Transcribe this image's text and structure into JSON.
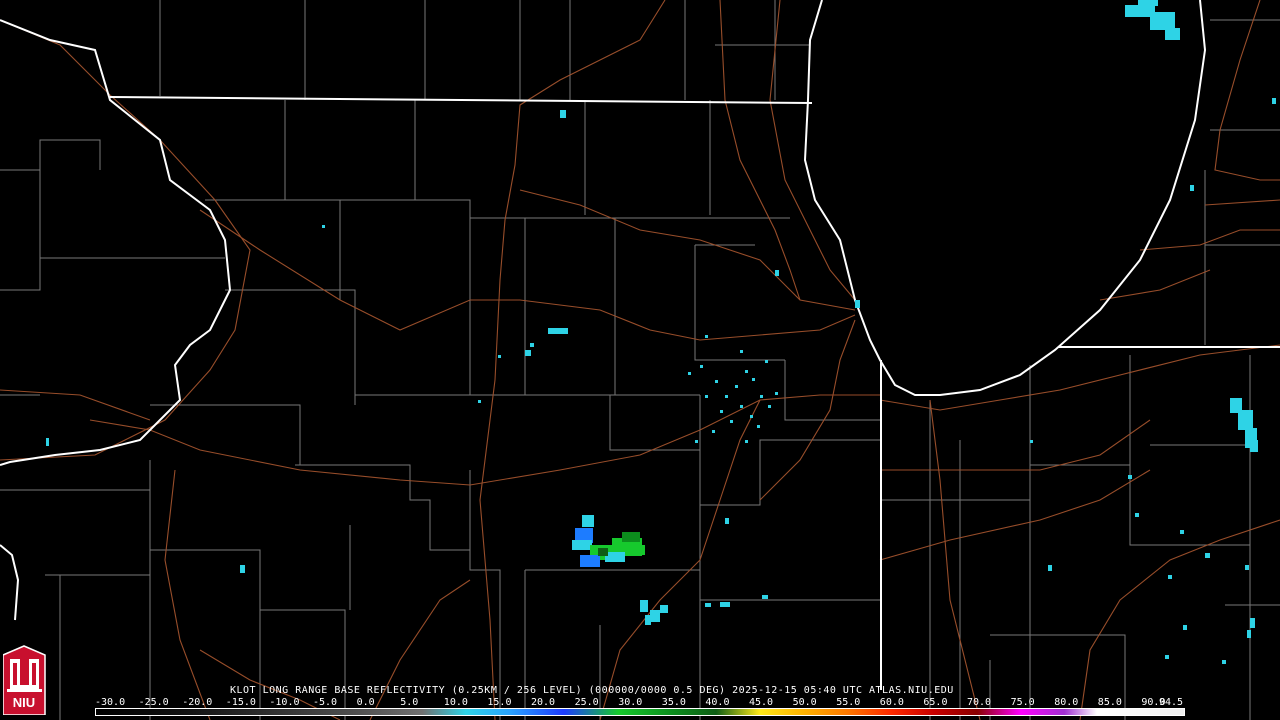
{
  "product": {
    "title": "KLOT LONG RANGE BASE REFLECTIVITY (0.25KM / 256 LEVEL) (000000/0000 0.5 DEG) 2025-12-15 05:40 UTC  ATLAS.NIU.EDU"
  },
  "colorbar": {
    "ticks": [
      "-30.0",
      "-25.0",
      "-20.0",
      "-15.0",
      "-10.0",
      "-5.0",
      "0.0",
      "5.0",
      "10.0",
      "15.0",
      "20.0",
      "25.0",
      "30.0",
      "35.0",
      "40.0",
      "45.0",
      "50.0",
      "55.0",
      "60.0",
      "65.0",
      "70.0",
      "75.0",
      "80.0",
      "85.0",
      "90.0",
      "94.5"
    ]
  },
  "logo": {
    "text": "NIU",
    "color": "#c8102e"
  },
  "colors": {
    "background": "#000000",
    "state_lines": "#ffffff",
    "county_lines": "#9a9a9a",
    "roads": "#a0522d",
    "echo_light": "#2ed3e6",
    "echo_mid": "#1d7cff",
    "echo_green": "#16c92d"
  }
}
